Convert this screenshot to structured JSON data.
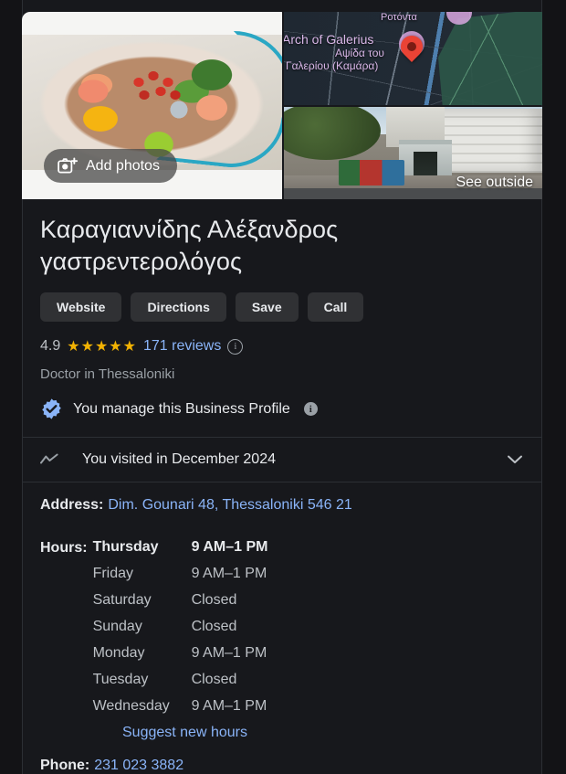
{
  "media": {
    "photo": {
      "alt": "heart-shaped-bowl-of-fruit-and-vegetables-with-stethoscope"
    },
    "add_photos_label": "Add photos",
    "map": {
      "labels": {
        "rotonta": "Ροτόντα",
        "arch_en": "Arch of Galerius",
        "arch_gr_line1": "Αψίδα του",
        "arch_gr_line2": "Γαλερίου (Καμάρα)"
      }
    },
    "street_view_label": "See outside"
  },
  "business": {
    "title": "Καραγιαννίδης Αλέξανδρος γαστρεντερολόγος",
    "actions": [
      {
        "label": "Website"
      },
      {
        "label": "Directions"
      },
      {
        "label": "Save"
      },
      {
        "label": "Call"
      }
    ],
    "rating": {
      "score": "4.9",
      "stars": "★★★★★",
      "reviews_label": "171 reviews"
    },
    "category": "Doctor in Thessaloniki",
    "manage_notice": "You manage this Business Profile"
  },
  "visited": {
    "text": "You visited in December 2024"
  },
  "address": {
    "label": "Address:",
    "value": "Dim. Gounari 48, Thessaloniki 546 21"
  },
  "hours": {
    "label": "Hours:",
    "rows": [
      {
        "day": "Thursday",
        "time": "9 AM–1 PM",
        "today": true
      },
      {
        "day": "Friday",
        "time": "9 AM–1 PM",
        "today": false
      },
      {
        "day": "Saturday",
        "time": "Closed",
        "today": false
      },
      {
        "day": "Sunday",
        "time": "Closed",
        "today": false
      },
      {
        "day": "Monday",
        "time": "9 AM–1 PM",
        "today": false
      },
      {
        "day": "Tuesday",
        "time": "Closed",
        "today": false
      },
      {
        "day": "Wednesday",
        "time": "9 AM–1 PM",
        "today": false
      }
    ],
    "suggest_label": "Suggest new hours"
  },
  "phone": {
    "label": "Phone:",
    "value": "231 023 3882"
  },
  "colors": {
    "background": "#131316",
    "panel": "#17181c",
    "link": "#8ab4f8",
    "text_primary": "#e8eaed",
    "text_secondary": "#9aa0a6",
    "star": "#f2b203",
    "button": "#303134",
    "verified_badge": "#8ab4f8",
    "map_pin": "#ea4335"
  }
}
